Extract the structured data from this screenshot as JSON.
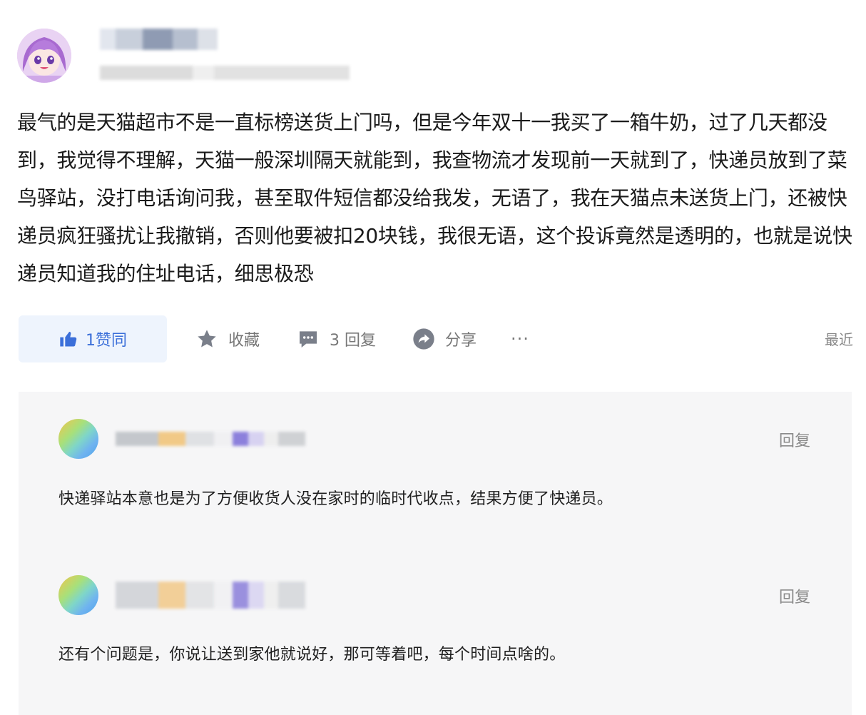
{
  "post": {
    "body": "最气的是天猫超市不是一直标榜送货上门吗，但是今年双十一我买了一箱牛奶，过了几天都没到，我觉得不理解，天猫一般深圳隔天就能到，我查物流才发现前一天就到了，快递员放到了菜鸟驿站，没打电话询问我，甚至取件短信都没给我发，无语了，我在天猫点未送货上门，还被快递员疯狂骚扰让我撤销，否则他要被扣20块钱，我很无语，这个投诉竟然是透明的，也就是说快递员知道我的住址电话，细思极恐"
  },
  "actions": {
    "like_label": "1赞同",
    "favorite_label": "收藏",
    "reply_label": "3 回复",
    "share_label": "分享",
    "more_label": "···",
    "sort_label": "最近"
  },
  "comments": [
    {
      "reply_label": "回复",
      "text": "快递驿站本意也是为了方便收货人没在家时的临时代收点，结果方便了快递员。"
    },
    {
      "reply_label": "回复",
      "text": "还有个问题是，你说让送到家他就说好，那可等着吧，每个时间点啥的。"
    }
  ],
  "colors": {
    "accent": "#3b6fd9",
    "like_bg": "#eef4fd",
    "comment_bg": "#f6f6f7",
    "muted": "#777777"
  },
  "icons": [
    "avatar",
    "thumbs-up-icon",
    "star-icon",
    "comment-icon",
    "share-icon",
    "more-icon"
  ]
}
